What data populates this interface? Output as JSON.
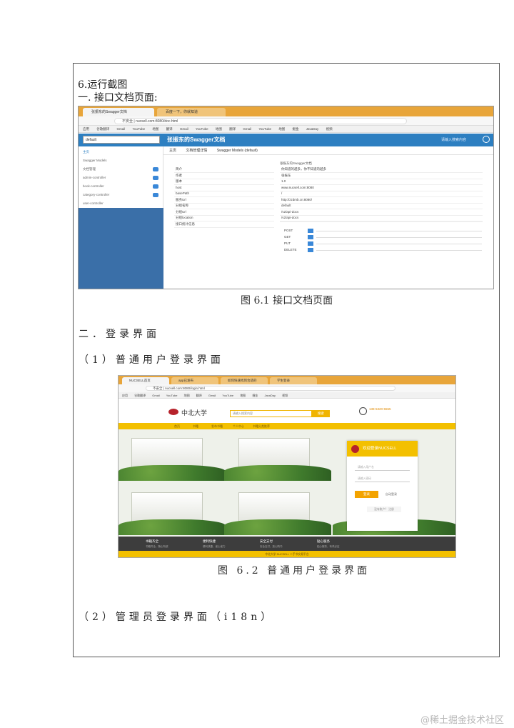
{
  "document": {
    "section_heading": "6.运行截图",
    "subheading_1": "一. 接口文档页面:",
    "caption_1": "图 6.1 接口文档页面",
    "heading_2": "二．登录界面",
    "heading_2a": "（1）普通用户登录界面",
    "caption_2": "图 6.2 普通用户登录界面",
    "heading_2b": "（2）管理员登录界面（i18n）"
  },
  "watermark": "@稀土掘金技术社区",
  "figure_1": {
    "tabs": [
      "张振东的Swagger文档",
      "百度一下，你就知道"
    ],
    "url": "不安全 | nucsell.com:8080/doc.html",
    "bookmarks": [
      "应用",
      "谷歌翻译",
      "Gmail",
      "YouTube",
      "地图",
      "翻译",
      "Gmail",
      "YouTube",
      "地图",
      "翻译",
      "Gmail",
      "YouTube",
      "地图",
      "掘金",
      "JavaDay",
      "视频"
    ],
    "group_select": "default",
    "header_title": "张振东的Swagger文档",
    "search_hint": "请输入搜索内容",
    "sidebar": [
      "主页",
      "Swagger Models",
      "文档管理",
      "admin-controller",
      "book-controller",
      "category-controller",
      "user-controller"
    ],
    "breadcrumbs": [
      "主页",
      "文档管理详情",
      "Swagger Models (default)"
    ],
    "doc_title": "张振东的Swagger文档",
    "rows": [
      {
        "k": "简介",
        "v": "你知道的越多，你不知道的越多"
      },
      {
        "k": "作者",
        "v": "张振东"
      },
      {
        "k": "版本",
        "v": "1.0"
      },
      {
        "k": "host",
        "v": "www.nucsell.com:8080"
      },
      {
        "k": "basePath",
        "v": "/"
      },
      {
        "k": "服务Url",
        "v": "http://zzdmb.cn:8080/"
      },
      {
        "k": "分组名称",
        "v": "default"
      },
      {
        "k": "分组Url",
        "v": "/v2/api-docs"
      },
      {
        "k": "分组location",
        "v": "/v2/api-docs"
      },
      {
        "k": "接口统计信息",
        "v": ""
      }
    ],
    "methods": [
      "POST",
      "GET",
      "PUT",
      "DELETE"
    ]
  },
  "figure_2": {
    "tabs": [
      "NUCSELL首页",
      "app已发布",
      "如何快速找到合适的",
      "学生登录"
    ],
    "url": "不安全 | nucsell.com:8080/login.html",
    "bookmarks": [
      "应用",
      "谷歌翻译",
      "Gmail",
      "YouTube",
      "地图",
      "翻译",
      "Gmail",
      "YouTube",
      "地图",
      "掘金",
      "JavaDay",
      "视频"
    ],
    "logo_text": "中北大学",
    "search_placeholder": "请输入搜索内容",
    "search_button": "搜索",
    "phone": "138-5320-5555",
    "nav": [
      "首页",
      "书籍",
      "发布书籍",
      "个人中心",
      "书籍分类推荐"
    ],
    "login_title": "欢迎登录NUCSELL",
    "username_placeholder": "请输入用户名",
    "password_placeholder": "请输入密码",
    "login_button": "登录",
    "remember": "自动登录",
    "register": "没有账户？ 注册",
    "footer": [
      {
        "title": "书籍齐全",
        "sub": "书籍齐全，随心所欲"
      },
      {
        "title": "便利快捷",
        "sub": "便利快捷，省心省力"
      },
      {
        "title": "安全支付",
        "sub": "安全支付，放心购书"
      },
      {
        "title": "贴心服务",
        "sub": "贴心服务，有求必应"
      }
    ],
    "bottom": "中北大学 NUCSELL 二手书交易平台"
  }
}
